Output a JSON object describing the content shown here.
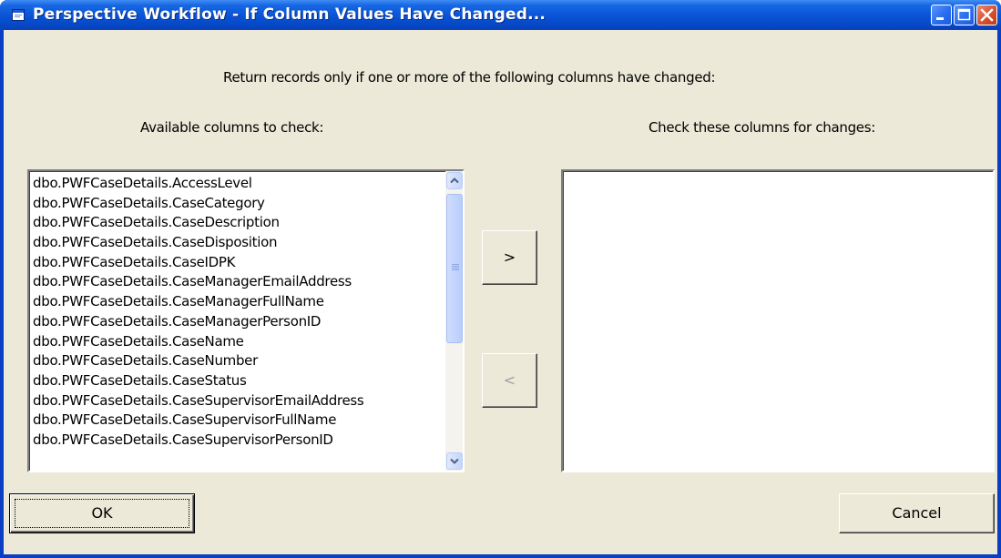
{
  "window": {
    "title": "Perspective Workflow - If Column Values Have Changed..."
  },
  "dialog": {
    "instruction": "Return records only if one or more of the following columns have changed:",
    "available_label": "Available columns to check:",
    "selected_label": "Check these columns for changes:",
    "available_columns": [
      "dbo.PWFCaseDetails.AccessLevel",
      "dbo.PWFCaseDetails.CaseCategory",
      "dbo.PWFCaseDetails.CaseDescription",
      "dbo.PWFCaseDetails.CaseDisposition",
      "dbo.PWFCaseDetails.CaseIDPK",
      "dbo.PWFCaseDetails.CaseManagerEmailAddress",
      "dbo.PWFCaseDetails.CaseManagerFullName",
      "dbo.PWFCaseDetails.CaseManagerPersonID",
      "dbo.PWFCaseDetails.CaseName",
      "dbo.PWFCaseDetails.CaseNumber",
      "dbo.PWFCaseDetails.CaseStatus",
      "dbo.PWFCaseDetails.CaseSupervisorEmailAddress",
      "dbo.PWFCaseDetails.CaseSupervisorFullName",
      "dbo.PWFCaseDetails.CaseSupervisorPersonID"
    ],
    "selected_columns": [],
    "add_label": ">",
    "remove_label": "<",
    "ok_label": "OK",
    "cancel_label": "Cancel"
  },
  "icons": {
    "app": "window-app-icon",
    "minimize": "minimize-icon",
    "maximize": "maximize-icon",
    "close": "close-icon",
    "scroll_up": "chevron-up-icon",
    "scroll_down": "chevron-down-icon"
  },
  "colors": {
    "titlebar": "#0a55d8",
    "dialog_bg": "#ece9d8",
    "close_button": "#d75230"
  }
}
